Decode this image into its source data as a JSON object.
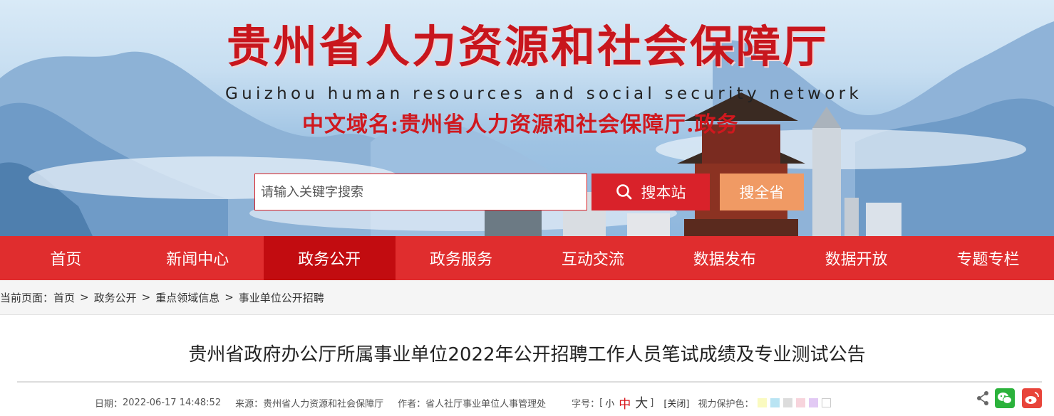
{
  "header": {
    "title_cn": "贵州省人力资源和社会保障厅",
    "title_en": "Guizhou human resources and social security network",
    "domain_label": "中文域名:贵州省人力资源和社会保障厅.政务"
  },
  "search": {
    "placeholder": "请输入关键字搜索",
    "site_button": "搜本站",
    "province_button": "搜全省"
  },
  "nav": {
    "items": [
      "首页",
      "新闻中心",
      "政务公开",
      "政务服务",
      "互动交流",
      "数据发布",
      "数据开放",
      "专题专栏"
    ],
    "active_index": 2
  },
  "breadcrumb": {
    "prefix": "当前页面：",
    "items": [
      "首页",
      "政务公开",
      "重点领域信息",
      "事业单位公开招聘"
    ],
    "separator": ">"
  },
  "article": {
    "title": "贵州省政府办公厅所属事业单位2022年公开招聘工作人员笔试成绩及专业测试公告",
    "date_label": "日期：",
    "date": "2022-06-17 14:48:52",
    "source_label": "来源：",
    "source": "贵州省人力资源和社会保障厅",
    "author_label": "作者：",
    "author": "省人社厅事业单位人事管理处",
    "font_label": "字号：",
    "bracket_open": "[",
    "font_small": "小",
    "font_medium": "中",
    "font_large": "大",
    "bracket_close": "]",
    "close_label": "[关闭]",
    "eye_label": "视力保护色："
  },
  "colors": {
    "brand_red": "#e02d2e",
    "nav_active": "#c20c10",
    "search_button": "#d9222a",
    "province_button": "#f09a64",
    "eye_swatches": [
      "#fafac0",
      "#b9e4f3",
      "#dcdcdc",
      "#f7d4dc",
      "#e2c9f4",
      "#ffffff"
    ]
  },
  "icons": [
    "search-icon",
    "share-icon",
    "wechat-icon",
    "weibo-icon"
  ]
}
